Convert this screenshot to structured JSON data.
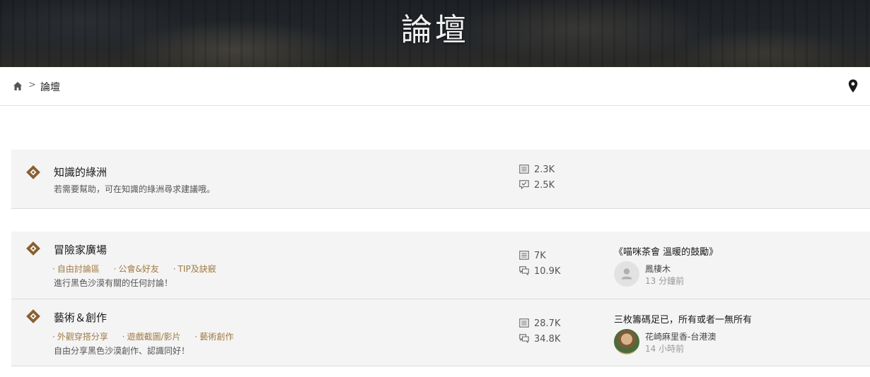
{
  "hero": {
    "title": "論壇"
  },
  "breadcrumb": {
    "separator": ">",
    "current": "論壇",
    "home_icon": "home-icon",
    "location_icon": "map-pin-icon"
  },
  "colors": {
    "accent": "#a07a45",
    "row_bg": "#f4f4f4",
    "icon_brown": "#8a5f2e"
  },
  "forums": [
    {
      "title": "知識的綠洲",
      "description": "若需要幫助，可在知識的綠洲尋求建議哦。",
      "sub_links": [],
      "posts": "2.3K",
      "replies": "2.5K",
      "replies_icon": "check-comment-icon",
      "latest": null
    },
    {
      "title": "冒險家廣場",
      "description": "進行黑色沙漠有關的任何討論！",
      "sub_links": [
        "自由討論區",
        "公會&好友",
        "TIP及訣竅"
      ],
      "posts": "7K",
      "replies": "10.9K",
      "replies_icon": "comments-icon",
      "latest": {
        "topic": "《喵咪茶會 溫暖的鼓勵》",
        "author": "鳳棲木",
        "time": "13 分鐘前"
      }
    },
    {
      "title": "藝術＆創作",
      "description": "自由分享黑色沙漠創作、認識同好！",
      "sub_links": [
        "外觀穿搭分享",
        "遊戲截圖/影片",
        "藝術創作"
      ],
      "posts": "28.7K",
      "replies": "34.8K",
      "replies_icon": "comments-icon",
      "latest": {
        "topic": "三枚籌碼足已，所有或者一無所有",
        "author": "花崎麻里香-台港澳",
        "time": "14 小時前"
      }
    }
  ]
}
